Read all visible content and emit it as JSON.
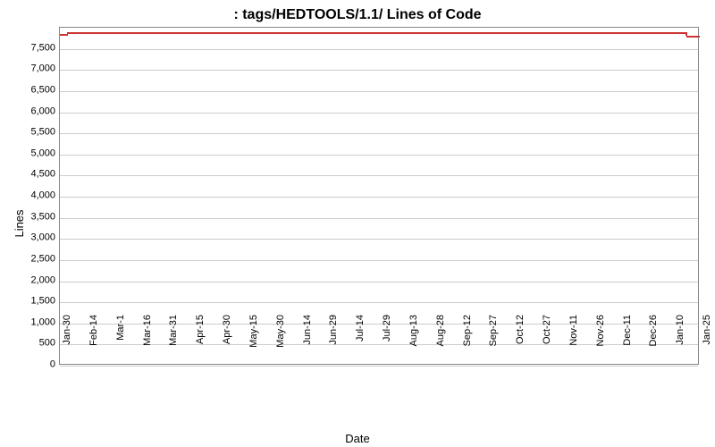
{
  "chart_data": {
    "type": "line",
    "title": ": tags/HEDTOOLS/1.1/ Lines of Code",
    "xlabel": "Date",
    "ylabel": "Lines",
    "ylim": [
      0,
      8000
    ],
    "yticks": [
      0,
      500,
      1000,
      1500,
      2000,
      2500,
      3000,
      3500,
      4000,
      4500,
      5000,
      5500,
      6000,
      6500,
      7000,
      7500
    ],
    "xticks": [
      "30-Jan",
      "14-Feb",
      "1-Mar",
      "16-Mar",
      "31-Mar",
      "15-Apr",
      "30-Apr",
      "15-May",
      "30-May",
      "14-Jun",
      "29-Jun",
      "14-Jul",
      "29-Jul",
      "13-Aug",
      "28-Aug",
      "12-Sep",
      "27-Sep",
      "12-Oct",
      "27-Oct",
      "11-Nov",
      "26-Nov",
      "11-Dec",
      "26-Dec",
      "10-Jan",
      "25-Jan"
    ],
    "series": [
      {
        "name": "Lines of Code",
        "color": "#cc3333",
        "x": [
          "30-Jan",
          "14-Feb",
          "1-Mar",
          "16-Mar",
          "31-Mar",
          "15-Apr",
          "30-Apr",
          "15-May",
          "30-May",
          "14-Jun",
          "29-Jun",
          "14-Jul",
          "29-Jul",
          "13-Aug",
          "28-Aug",
          "12-Sep",
          "27-Sep",
          "12-Oct",
          "27-Oct",
          "11-Nov",
          "26-Nov",
          "11-Dec",
          "26-Dec",
          "10-Jan",
          "25-Jan"
        ],
        "values": [
          7850,
          7900,
          7900,
          7900,
          7900,
          7900,
          7900,
          7900,
          7900,
          7900,
          7900,
          7900,
          7900,
          7900,
          7900,
          7900,
          7900,
          7900,
          7900,
          7900,
          7900,
          7900,
          7900,
          7900,
          7800
        ]
      }
    ]
  }
}
